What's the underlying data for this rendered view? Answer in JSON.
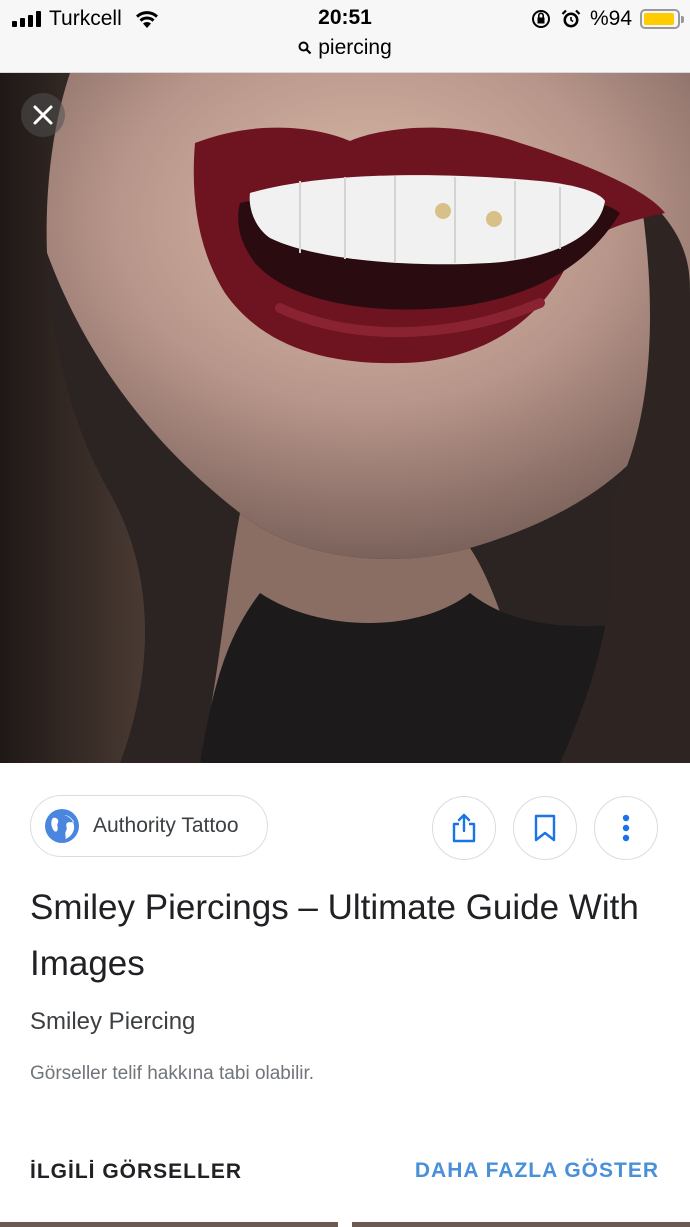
{
  "status_bar": {
    "carrier": "Turkcell",
    "time": "20:51",
    "battery_percent": "%94",
    "battery_level": 0.94
  },
  "url_bar": {
    "query": "piercing",
    "icon": "search-icon"
  },
  "image": {
    "close_icon": "close-icon"
  },
  "details": {
    "source_name": "Authority Tattoo",
    "source_icon": "globe-icon",
    "title": "Smiley Piercings – Ultimate Guide With Images",
    "subtitle": "Smiley Piercing",
    "copyright_notice": "Görseller telif hakkına tabi olabilir.",
    "actions": [
      "share-icon",
      "bookmark-icon",
      "more-vert-icon"
    ]
  },
  "related": {
    "heading": "İLGİLİ GÖRSELLER",
    "more_label": "DAHA FAZLA GÖSTER"
  },
  "colors": {
    "accent": "#4a90d9",
    "lip": "#6e1320",
    "battery": "#ffcc00"
  }
}
